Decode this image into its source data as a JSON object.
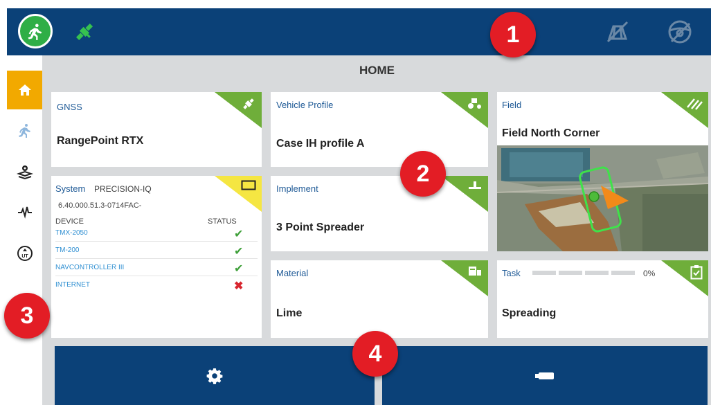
{
  "topbar": {
    "run_icon": "running-person-icon",
    "satellite_icon": "satellite-icon",
    "field_off_icon": "field-disabled-icon",
    "steering_off_icon": "steering-disabled-icon"
  },
  "page_title": "HOME",
  "sidebar": {
    "items": [
      {
        "icon": "home-icon",
        "active": true
      },
      {
        "icon": "running-person-icon",
        "active": false
      },
      {
        "icon": "field-setup-icon",
        "active": false
      },
      {
        "icon": "diagnostics-pulse-icon",
        "active": false
      },
      {
        "icon": "utility-icon",
        "active": false
      }
    ]
  },
  "cards": {
    "gnss": {
      "label": "GNSS",
      "value": "RangePoint RTX",
      "icon": "satellite-icon"
    },
    "vehicle": {
      "label": "Vehicle Profile",
      "value": "Case IH profile A",
      "icon": "tractor-icon"
    },
    "field": {
      "label": "Field",
      "value": "Field North Corner",
      "icon": "field-lines-icon"
    },
    "implement": {
      "label": "Implement",
      "value": "3 Point Spreader",
      "icon": "implement-icon"
    },
    "material": {
      "label": "Material",
      "value": "Lime",
      "icon": "material-icon"
    },
    "task": {
      "label": "Task",
      "value": "Spreading",
      "progress_text": "0%",
      "progress": 0,
      "icon": "clipboard-check-icon"
    }
  },
  "system": {
    "label": "System",
    "name": "PRECISION-IQ",
    "version": "6.40.000.51.3-0714FAC-",
    "col_device": "DEVICE",
    "col_status": "STATUS",
    "devices": [
      {
        "name": "TMX-2050",
        "status": "✔"
      },
      {
        "name": "TM-200",
        "status": "✔"
      },
      {
        "name": "NAVCONTROLLER III",
        "status": "✔"
      },
      {
        "name": "INTERNET",
        "status": "✖"
      }
    ]
  },
  "bottom": {
    "settings_icon": "gear-icon",
    "right_icon": "usb-drive-icon"
  },
  "badges": [
    "1",
    "2",
    "3",
    "4"
  ],
  "colors": {
    "navy": "#0b4178",
    "green": "#2fae46",
    "accent_orange": "#f2a900",
    "badge_red": "#e31d25",
    "status_yellow": "#f5e642"
  }
}
